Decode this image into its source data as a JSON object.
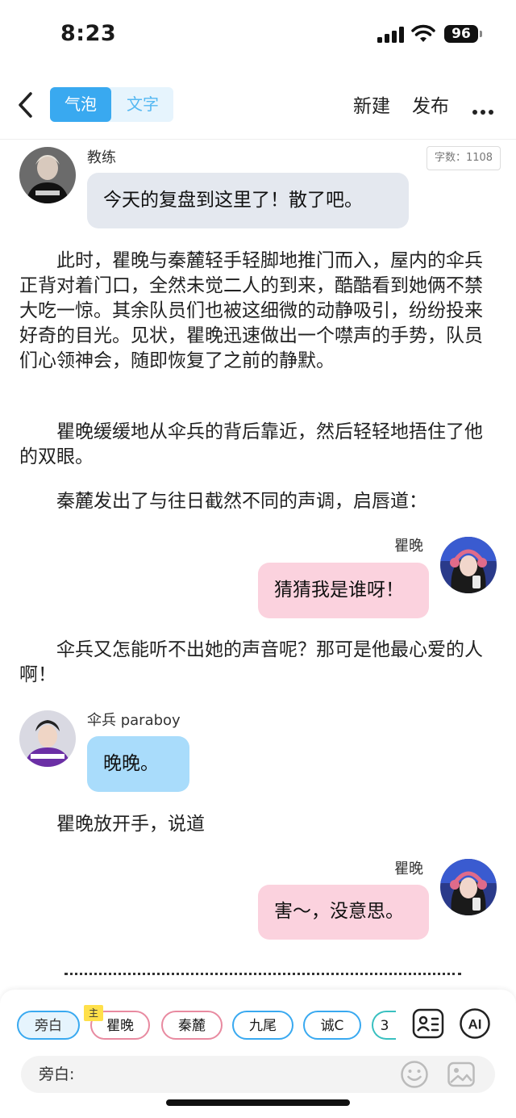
{
  "status_bar": {
    "time": "8:23",
    "battery": "96"
  },
  "nav": {
    "tabs": [
      {
        "label": "气泡",
        "active": true
      },
      {
        "label": "文字",
        "active": false
      }
    ],
    "new_label": "新建",
    "publish_label": "发布"
  },
  "word_count": "字数：1108",
  "messages": [
    {
      "speaker": "教练",
      "text": "今天的复盘到这里了！散了吧。"
    },
    {
      "speaker": "瞿晚",
      "text": "猜猜我是谁呀！"
    },
    {
      "speaker": "伞兵 paraboy",
      "text": "晚晚。"
    },
    {
      "speaker": "瞿晚",
      "text": "害～，没意思。"
    }
  ],
  "narration": [
    "此时，瞿晚与秦麓轻手轻脚地推门而入，屋内的伞兵正背对着门口，全然未觉二人的到来，酷酷看到她俩不禁大吃一惊。其余队员们也被这细微的动静吸引，纷纷投来好奇的目光。见状，瞿晚迅速做出一个噤声的手势，队员们心领神会，随即恢复了之前的静默。",
    "瞿晚缓缓地从伞兵的背后靠近，然后轻轻地捂住了他的双眼。",
    "秦麓发出了与往日截然不同的声调，启唇道：",
    "伞兵又怎能听不出她的声音呢？那可是他最心爱的人啊！",
    "瞿晚放开手，说道"
  ],
  "characters": [
    {
      "label": "旁白",
      "selected": true,
      "border": "#39a9f0"
    },
    {
      "label": "瞿晚",
      "badge": "主",
      "border": "#e88aa0"
    },
    {
      "label": "秦麓",
      "border": "#e88aa0"
    },
    {
      "label": "九尾",
      "border": "#39a9f0"
    },
    {
      "label": "诚C",
      "border": "#39a9f0"
    },
    {
      "label": "3",
      "border": "#39c0c0"
    }
  ],
  "input": {
    "prefix": "旁白:"
  },
  "colors": {
    "accent": "#39a9f0",
    "bubble_gray": "#e4e8ef",
    "bubble_pink": "#fbd2de",
    "bubble_blue": "#a9dcfb"
  },
  "icons": [
    "back-icon",
    "more-icon",
    "character-card-icon",
    "ai-icon",
    "emoji-icon",
    "image-icon"
  ]
}
